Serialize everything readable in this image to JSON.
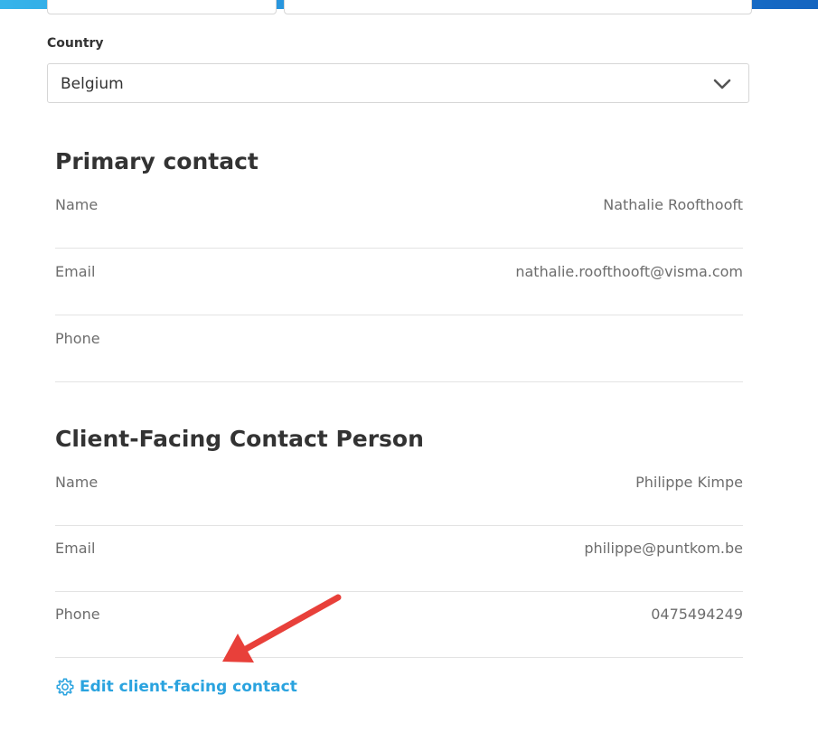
{
  "country": {
    "label": "Country",
    "selected": "Belgium"
  },
  "primary_contact": {
    "title": "Primary contact",
    "rows": [
      {
        "label": "Name",
        "value": "Nathalie Roofthooft"
      },
      {
        "label": "Email",
        "value": "nathalie.roofthooft@visma.com"
      },
      {
        "label": "Phone",
        "value": ""
      }
    ]
  },
  "client_facing_contact": {
    "title": "Client-Facing Contact Person",
    "rows": [
      {
        "label": "Name",
        "value": "Philippe Kimpe"
      },
      {
        "label": "Email",
        "value": "philippe@puntkom.be"
      },
      {
        "label": "Phone",
        "value": "0475494249"
      }
    ],
    "edit_link_label": "Edit client-facing contact"
  },
  "colors": {
    "accent": "#2aa3df",
    "annotation_arrow": "#e8403a",
    "top_bar": "#1e7fd4"
  },
  "icons": {
    "select_toggle": "chevron-down-icon",
    "edit": "gear-icon",
    "annotation": "red-arrow-annotation"
  }
}
